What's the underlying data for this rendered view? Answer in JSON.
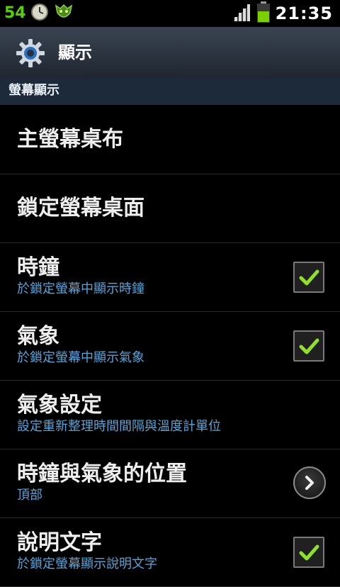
{
  "status_bar": {
    "notification_count": "54",
    "time": "21:35",
    "colors": {
      "count": "#58d000",
      "battery": "#7ad000"
    }
  },
  "title_bar": {
    "title": "顯示",
    "icon": "gear-icon"
  },
  "section_header": "螢幕顯示",
  "items": [
    {
      "title": "主螢幕桌布",
      "subtitle": "",
      "control": "none"
    },
    {
      "title": "鎖定螢幕桌面",
      "subtitle": "",
      "control": "none"
    },
    {
      "title": "時鐘",
      "subtitle": "於鎖定螢幕中顯示時鐘",
      "control": "checkbox",
      "checked": true
    },
    {
      "title": "氣象",
      "subtitle": "於鎖定螢幕中顯示氣象",
      "control": "checkbox",
      "checked": true
    },
    {
      "title": "氣象設定",
      "subtitle": "設定重新整理時間間隔與溫度計單位",
      "control": "none"
    },
    {
      "title": "時鐘與氣象的位置",
      "subtitle": "頂部",
      "control": "arrow"
    },
    {
      "title": "說明文字",
      "subtitle": "於鎖定螢幕顯示說明文字",
      "control": "checkbox",
      "checked": true
    }
  ]
}
